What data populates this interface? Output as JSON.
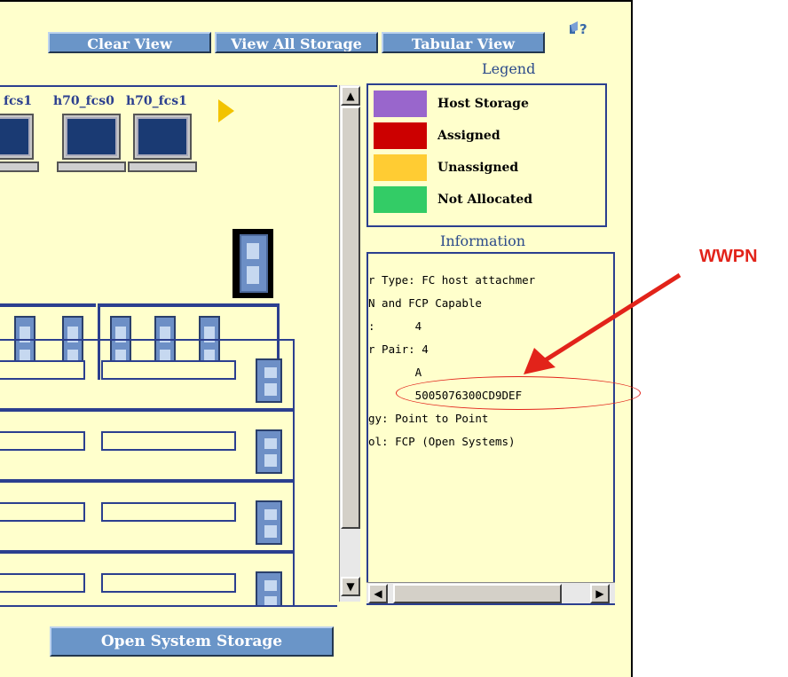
{
  "toolbar": {
    "clear_view": "Clear View",
    "view_all_storage": "View All Storage",
    "tabular_view": "Tabular View",
    "help_icon": "?"
  },
  "hosts": [
    {
      "label": "fcs1"
    },
    {
      "label": "h70_fcs0"
    },
    {
      "label": "h70_fcs1"
    }
  ],
  "legend": {
    "title": "Legend",
    "items": [
      {
        "label": "Host Storage",
        "color": "#9966cc"
      },
      {
        "label": "Assigned",
        "color": "#cc0000"
      },
      {
        "label": "Unassigned",
        "color": "#ffcc33"
      },
      {
        "label": "Not Allocated",
        "color": "#33cc66"
      }
    ]
  },
  "information": {
    "title": "Information",
    "lines": [
      "r Type: FC host attachmer",
      "N and FCP Capable",
      ":      4",
      "r Pair: 4",
      "       A",
      "       5005076300CD9DEF",
      "gy: Point to Point",
      "ol: FCP (Open Systems)"
    ]
  },
  "bottom_button": "Open System Storage",
  "annotation": {
    "label": "WWPN",
    "color": "#e2231a"
  }
}
